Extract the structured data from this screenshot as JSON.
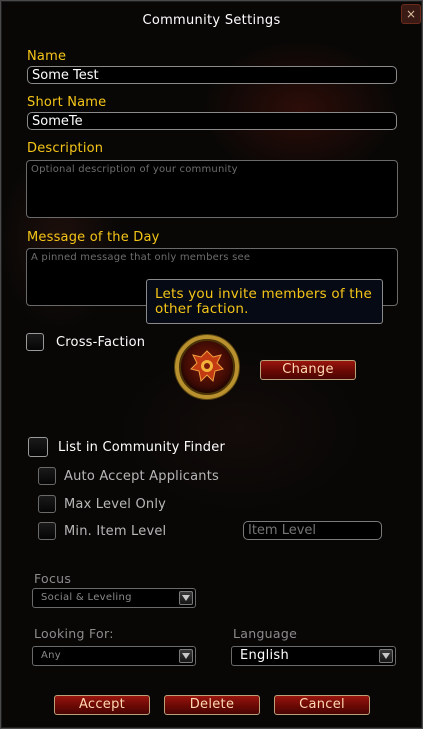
{
  "window": {
    "title": "Community Settings",
    "close_glyph": "×"
  },
  "name": {
    "label": "Name",
    "value": "Some Test"
  },
  "short_name": {
    "label": "Short Name",
    "value": "SomeTe"
  },
  "description": {
    "label": "Description",
    "placeholder": "Optional description of your community"
  },
  "motd": {
    "label": "Message of the Day",
    "placeholder": "A pinned message that only members see"
  },
  "tooltip": {
    "text": "Lets you invite members of the other faction."
  },
  "cross_faction": {
    "label": "Cross-Faction",
    "checked": false
  },
  "emblem": {
    "icon": "horde-crest-icon",
    "change_label": "Change"
  },
  "finder": {
    "label": "List in Community Finder",
    "auto_accept": "Auto Accept Applicants",
    "max_level": "Max Level Only",
    "min_item_level": "Min. Item Level",
    "item_level_placeholder": "Item Level"
  },
  "focus": {
    "label": "Focus",
    "value": "Social & Leveling"
  },
  "looking_for": {
    "label": "Looking For:",
    "value": "Any"
  },
  "language": {
    "label": "Language",
    "value": "English"
  },
  "buttons": {
    "accept": "Accept",
    "delete": "Delete",
    "cancel": "Cancel"
  },
  "colors": {
    "label_gold": "#f5c518",
    "button_red": "#7a0c07",
    "button_text": "#ffd9b0"
  }
}
